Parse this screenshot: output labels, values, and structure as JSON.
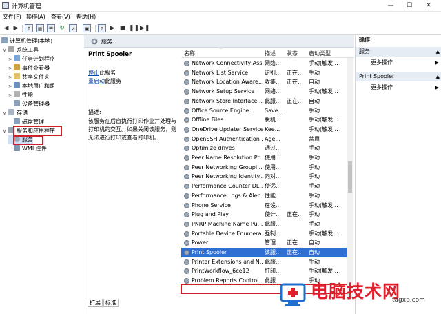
{
  "window": {
    "title": "计算机管理",
    "minimize": "—",
    "maximize": "☐",
    "close": "✕"
  },
  "menu": [
    "文件(F)",
    "操作(A)",
    "查看(V)",
    "帮助(H)"
  ],
  "tree": {
    "root": "计算机管理(本地)",
    "items": [
      {
        "label": "系统工具",
        "level": 1,
        "expander": "∨"
      },
      {
        "label": "任务计划程序",
        "level": 2,
        "expander": ">"
      },
      {
        "label": "事件查看器",
        "level": 2,
        "expander": ">"
      },
      {
        "label": "共享文件夹",
        "level": 2,
        "expander": ">"
      },
      {
        "label": "本地用户和组",
        "level": 2,
        "expander": ">"
      },
      {
        "label": "性能",
        "level": 2,
        "expander": ">"
      },
      {
        "label": "设备管理器",
        "level": 2,
        "expander": ""
      },
      {
        "label": "存储",
        "level": 1,
        "expander": "∨"
      },
      {
        "label": "磁盘管理",
        "level": 2,
        "expander": ""
      },
      {
        "label": "服务和应用程序",
        "level": 1,
        "expander": "∨"
      },
      {
        "label": "服务",
        "level": 2,
        "expander": ""
      },
      {
        "label": "WMI 控件",
        "level": 2,
        "expander": ""
      }
    ]
  },
  "services_header": "服务",
  "detail": {
    "name": "Print Spooler",
    "stop_link": "停止",
    "stop_suffix": "此服务",
    "restart_link": "重启动",
    "restart_suffix": "此服务",
    "desc_label": "描述:",
    "desc_text": "该服务在后台执行打印作业并处理与打印机的交互。如果关闭该服务，则无法进行打印或查看打印机。"
  },
  "columns": [
    "名称",
    "描述",
    "状态",
    "启动类型"
  ],
  "services": [
    [
      "Network Connectivity Ass...",
      "网络...",
      "",
      "手动(触发..."
    ],
    [
      "Network List Service",
      "识别...",
      "正在...",
      "手动"
    ],
    [
      "Network Location Aware...",
      "收集...",
      "正在...",
      "自动"
    ],
    [
      "Network Setup Service",
      "网络...",
      "",
      "手动(触发..."
    ],
    [
      "Network Store Interface ...",
      "此服...",
      "正在...",
      "自动"
    ],
    [
      "Office  Source Engine",
      "Save...",
      "",
      "手动"
    ],
    [
      "Offline Files",
      "脱机...",
      "",
      "手动(触发..."
    ],
    [
      "OneDrive Updater Service",
      "Kee...",
      "",
      "手动(触发..."
    ],
    [
      "OpenSSH Authentication ...",
      "Age...",
      "",
      "禁用"
    ],
    [
      "Optimize drives",
      "通过...",
      "",
      "手动"
    ],
    [
      "Peer Name Resolution Pr...",
      "使用...",
      "",
      "手动"
    ],
    [
      "Peer Networking Groupi...",
      "使用...",
      "",
      "手动"
    ],
    [
      "Peer Networking Identity...",
      "向对...",
      "",
      "手动"
    ],
    [
      "Performance Counter DL...",
      "使远...",
      "",
      "手动"
    ],
    [
      "Performance Logs & Aler...",
      "性能...",
      "",
      "手动"
    ],
    [
      "Phone Service",
      "在设...",
      "",
      "手动(触发..."
    ],
    [
      "Plug and Play",
      "使计...",
      "正在...",
      "手动"
    ],
    [
      "PNRP Machine Name Pu...",
      "此服...",
      "",
      "手动"
    ],
    [
      "Portable Device Enumera...",
      "强制...",
      "",
      "手动(触发..."
    ],
    [
      "Power",
      "管理...",
      "正在...",
      "自动"
    ],
    [
      "Print Spooler",
      "该服...",
      "正在...",
      "自动"
    ],
    [
      "Printer Extensions and N...",
      "此服...",
      "",
      "手动"
    ],
    [
      "PrintWorkflow_6ce12",
      "打印...",
      "",
      "手动(触发..."
    ],
    [
      "Problem Reports Control...",
      "此服...",
      "",
      "手动"
    ]
  ],
  "tabs": [
    "扩展",
    "标准"
  ],
  "actions": {
    "header": "操作",
    "groups": [
      {
        "title": "服务",
        "items": [
          "更多操作"
        ]
      },
      {
        "title": "Print Spooler",
        "items": [
          "更多操作"
        ]
      }
    ]
  },
  "watermark": {
    "text": "电脑技术网",
    "site": "tagxp.com"
  },
  "colors": {
    "selection": "#2f6fd4",
    "highlight_box": "#d0202a",
    "header_bg": "#e9eef5"
  }
}
